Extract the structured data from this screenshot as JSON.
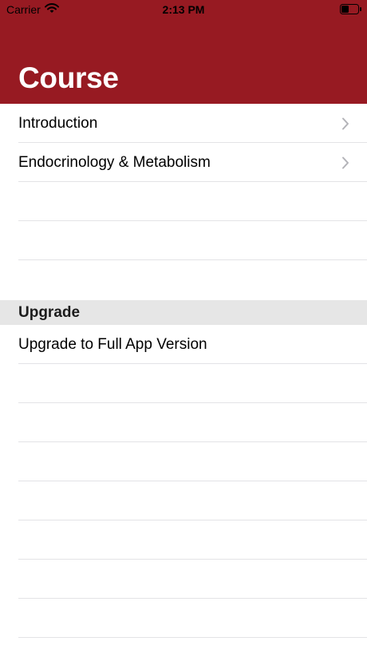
{
  "status_bar": {
    "carrier": "Carrier",
    "time": "2:13 PM"
  },
  "header": {
    "title": "Course",
    "background_color": "#971a22"
  },
  "course_list": {
    "items": [
      {
        "label": "Introduction",
        "icon": "chevron-right-icon"
      },
      {
        "label": "Endocrinology & Metabolism",
        "icon": "chevron-right-icon"
      }
    ]
  },
  "upgrade_section": {
    "title": "Upgrade",
    "items": [
      {
        "label": "Upgrade to Full App Version"
      }
    ]
  }
}
